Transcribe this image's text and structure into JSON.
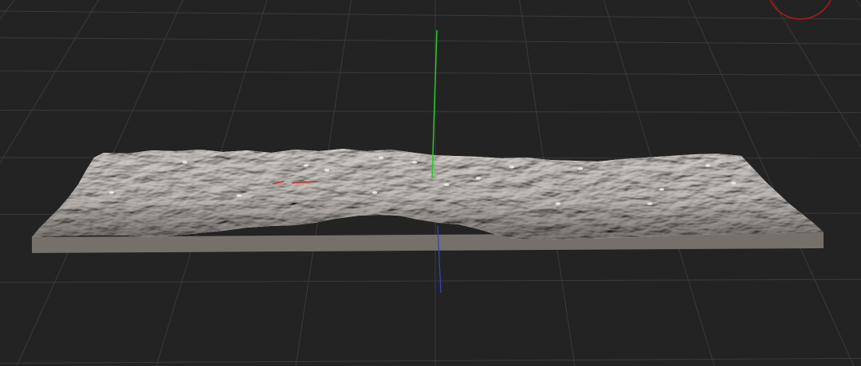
{
  "viewport": {
    "background": "#232323",
    "grid_color": "#3a3a3a",
    "grid_visible": true
  },
  "axes": {
    "x_color": "#cc3333",
    "y_color": "#22cc22",
    "z_color": "#3344bb"
  },
  "terrain": {
    "surface_color": "#c9c4bf",
    "shadow_color": "#7f7a74",
    "base_color": "#75706a"
  },
  "gizmo": {
    "color": "#b01818",
    "icon": "view-orbit-gizmo-icon"
  }
}
